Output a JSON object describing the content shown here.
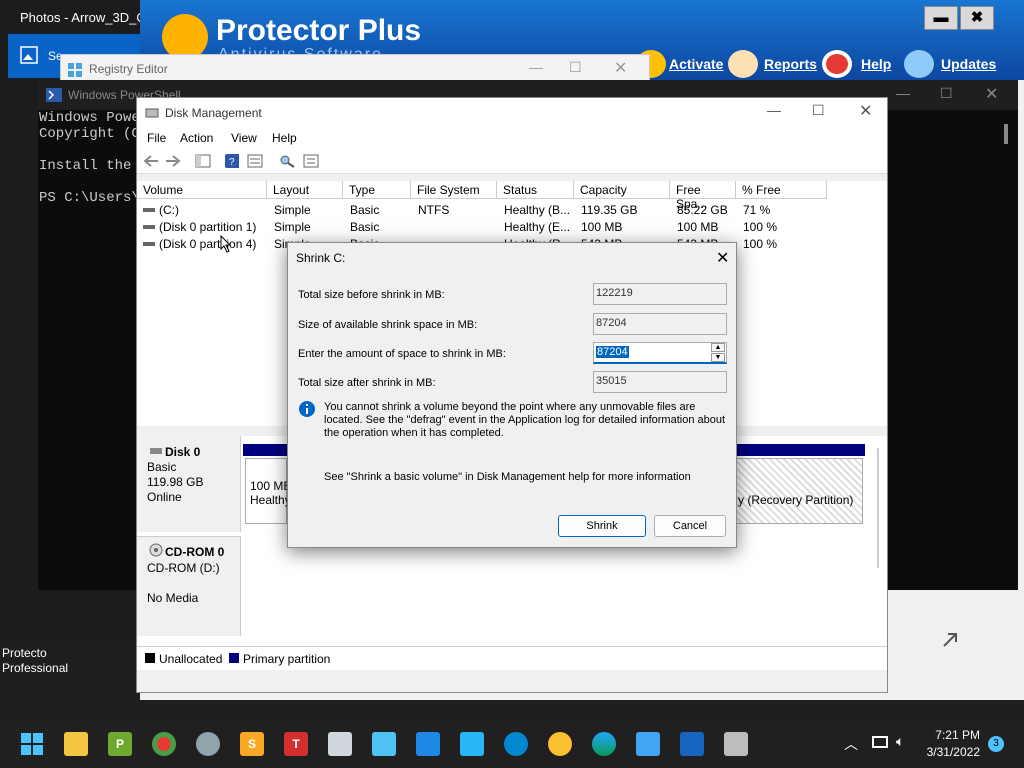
{
  "photos": {
    "title": "Photos - Arrow_3D_Or",
    "tile_text": "Se"
  },
  "protector": {
    "name": "Protector Plus",
    "subtitle": "Antivirus Software",
    "minimize": "▬",
    "close": "✖",
    "nav": [
      "Activate",
      "Reports",
      "Help",
      "Updates"
    ],
    "desktop_label": "Protecto\nProfessional"
  },
  "regedit": {
    "title": "Registry Editor"
  },
  "powershell": {
    "title": "Windows PowerShell",
    "lines": "Windows Powe\nCopyright (C\n\nInstall the \n\nPS C:\\Users\\"
  },
  "disk_mgmt": {
    "title": "Disk Management",
    "menu": [
      "File",
      "Action",
      "View",
      "Help"
    ],
    "columns": [
      "Volume",
      "Layout",
      "Type",
      "File System",
      "Status",
      "Capacity",
      "Free Spa...",
      "% Free"
    ],
    "rows": [
      [
        "(C:)",
        "Simple",
        "Basic",
        "NTFS",
        "Healthy (B...",
        "119.35 GB",
        "85.22 GB",
        "71 %"
      ],
      [
        "(Disk 0 partition 1)",
        "Simple",
        "Basic",
        "",
        "Healthy (E...",
        "100 MB",
        "100 MB",
        "100 %"
      ],
      [
        "(Disk 0 partition 4)",
        "Simple",
        "Basic",
        "",
        "Healthy (R...",
        "543 MB",
        "543 MB",
        "100 %"
      ]
    ],
    "disk0": {
      "name": "Disk 0",
      "type": "Basic",
      "size": "119.98 GB",
      "state": "Online",
      "part1_size": "100 MB",
      "part1_status": "Healthy",
      "part4_text": "y (Recovery Partition)"
    },
    "cdrom": {
      "name": "CD-ROM 0",
      "drive": "CD-ROM (D:)",
      "media": "No Media"
    },
    "legend": [
      "Unallocated",
      "Primary partition"
    ],
    "colors": {
      "unallocated": "#000000",
      "primary": "#00007f"
    }
  },
  "shrink": {
    "title": "Shrink C:",
    "total_before_label": "Total size before shrink in MB:",
    "total_before": "122219",
    "available_label": "Size of available shrink space in MB:",
    "available": "87204",
    "amount_label": "Enter the amount of space to shrink in MB:",
    "amount": "87204",
    "total_after_label": "Total size after shrink in MB:",
    "total_after": "35015",
    "info": "You cannot shrink a volume beyond the point where any unmovable files are located. See the \"defrag\" event in the Application log for detailed information about the operation when it has completed.",
    "help": "See \"Shrink a basic volume\" in Disk Management help for more information",
    "shrink_button": "Shrink",
    "cancel_button": "Cancel"
  },
  "taskbar": {
    "time": "7:21 PM",
    "date": "3/31/2022",
    "badge": "3",
    "icons": [
      "start-icon",
      "file-explorer-icon",
      "protector-plus-icon",
      "chrome-icon",
      "network-icon",
      "s-app-icon",
      "t-app-icon",
      "snipping-icon",
      "notepad-icon",
      "photos-icon",
      "people-icon",
      "help-icon",
      "paint-icon",
      "edge-icon",
      "settings-icon",
      "powershell-icon",
      "disk-management-icon"
    ]
  }
}
